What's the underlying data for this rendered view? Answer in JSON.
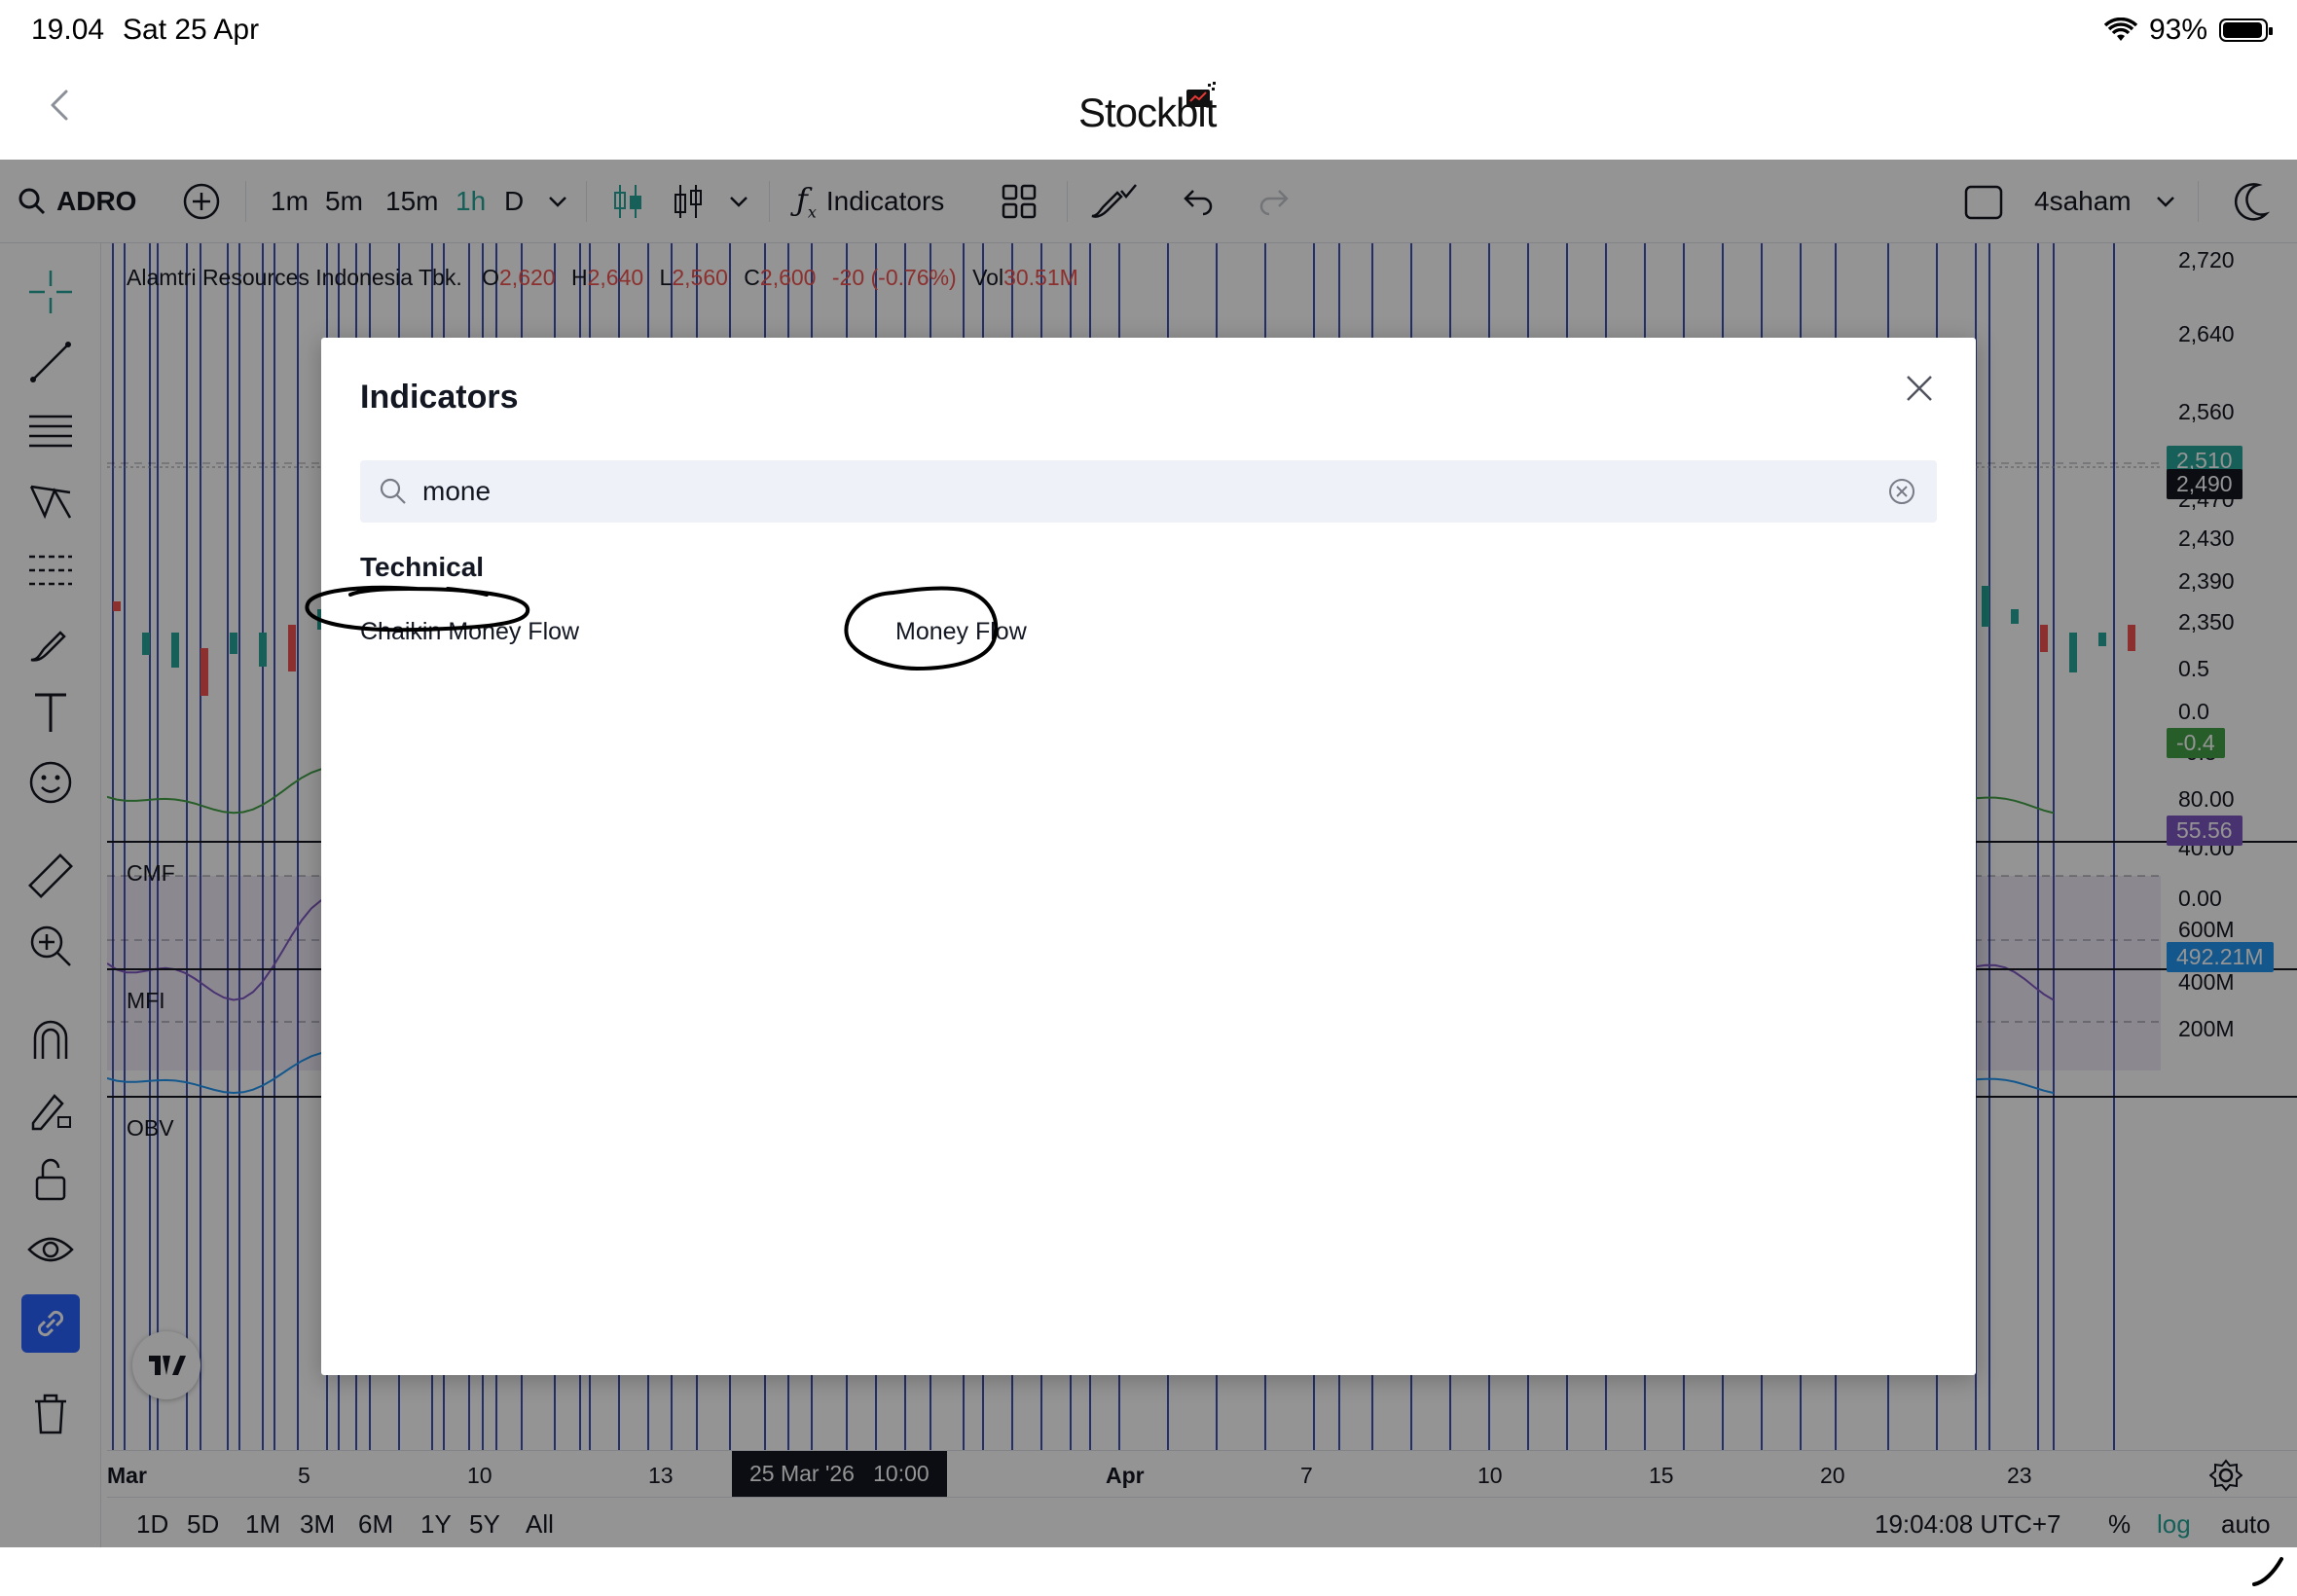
{
  "status_bar": {
    "time": "19.04",
    "date": "Sat 25 Apr",
    "battery": "93%"
  },
  "app": {
    "brand": "Stockbit"
  },
  "toolbar": {
    "symbol": "ADRO",
    "intervals": [
      "1m",
      "5m",
      "15m",
      "1h",
      "D"
    ],
    "active_interval": "1h",
    "indicators_label": "Indicators",
    "layout_name": "4saham"
  },
  "chart": {
    "legend": {
      "name": "Alamtri Resources Indonesia Tbk.",
      "o_label": "O",
      "o_value": "2,620",
      "h_label": "H",
      "h_value": "2,640",
      "l_label": "L",
      "l_value": "2,560",
      "c_label": "C",
      "c_value": "2,600",
      "change": "-20 (-0.76%)",
      "vol_label": "Vol",
      "vol_value": "30.51M"
    },
    "pane_labels": [
      "CMF",
      "MFI",
      "OBV"
    ],
    "price_scale": [
      "2,720",
      "2,640",
      "2,560",
      "2,470",
      "2,430",
      "2,390",
      "2,350"
    ],
    "price_tags": {
      "last": "2,510",
      "cursor": "2,490"
    },
    "cmf_scale": [
      "0.5",
      "0.0",
      "-0.5"
    ],
    "cmf_tag": "-0.4",
    "mfi_scale": [
      "80.00",
      "40.00",
      "0.00"
    ],
    "mfi_tag": "55.56",
    "obv_scale": [
      "600M",
      "400M",
      "200M"
    ],
    "obv_tag": "492.21M",
    "time_scale": [
      "Mar",
      "5",
      "10",
      "13",
      "Apr",
      "7",
      "10",
      "15",
      "20",
      "23"
    ],
    "crosshair_time": "25 Mar '26   10:00",
    "ranges": [
      "1D",
      "5D",
      "1M",
      "3M",
      "6M",
      "1Y",
      "5Y",
      "All"
    ],
    "clock": "19:04:08 UTC+7",
    "scale_modes": [
      "%",
      "log",
      "auto"
    ],
    "colors": {
      "up": "#26a69a",
      "down": "#ef5350",
      "accent": "#2962ff",
      "mfi": "#7e57c2",
      "obv": "#2196f3",
      "cmf": "#43a047"
    }
  },
  "modal": {
    "title": "Indicators",
    "search_value": "mone",
    "section": "Technical",
    "results": [
      "Chaikin Money Flow",
      "Money Flow"
    ]
  }
}
